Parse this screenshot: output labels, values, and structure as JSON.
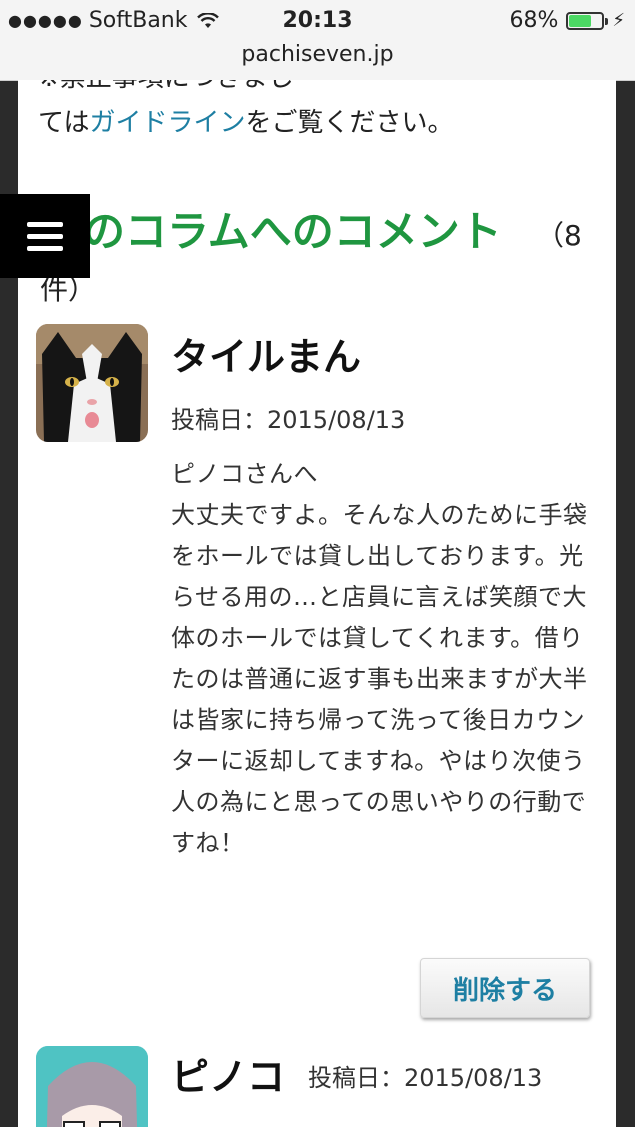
{
  "status_bar": {
    "carrier": "SoftBank",
    "signal_dots": "●●●●●",
    "time": "20:13",
    "battery_percent": "68%",
    "battery_level": 0.68,
    "url": "pachiseven.jp"
  },
  "guideline": {
    "partial_line": "※禁止事項につきまし",
    "prefix": "ては",
    "link": "ガイドライン",
    "suffix": "をご覧ください。"
  },
  "section": {
    "title": "のコラムへのコメント",
    "count_part1": "（8",
    "count_part2": "件）"
  },
  "comments": [
    {
      "name": "タイルまん",
      "date": "投稿日：2015/08/13",
      "body": "ピノコさんへ\n大丈夫ですよ。そんな人のために手袋をホールでは貸し出しております。光らせる用の…と店員に言えば笑顔で大体のホールでは貸してくれます。借りたのは普通に返す事も出来ますが大半は皆家に持ち帰って洗って後日カウンターに返却してますね。やはり次使う人の為にと思っての思いやりの行動ですね！",
      "delete_label": "削除する"
    },
    {
      "name": "ピノコ",
      "date": "投稿日：2015/08/13"
    }
  ],
  "colors": {
    "section_title": "#1f9640",
    "link": "#1e7fa3",
    "battery": "#4cd964"
  }
}
